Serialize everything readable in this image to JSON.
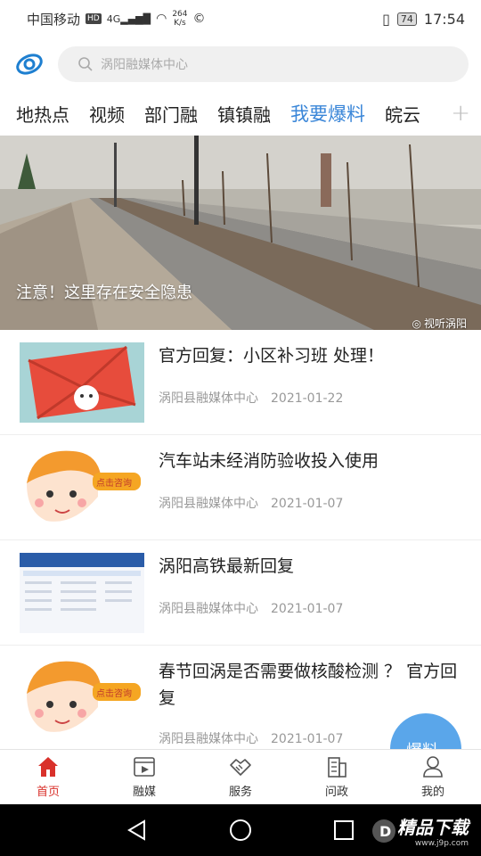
{
  "status_bar": {
    "carrier": "中国移动",
    "hd": "HD",
    "network": "4G",
    "speed_value": "264",
    "speed_unit": "K/s",
    "battery": "74",
    "time": "17:54"
  },
  "header": {
    "search_placeholder": "涡阳融媒体中心"
  },
  "tabs": [
    {
      "label": "地热点",
      "active": false
    },
    {
      "label": "视频",
      "active": false
    },
    {
      "label": "部门融",
      "active": false
    },
    {
      "label": "镇镇融",
      "active": false
    },
    {
      "label": "我要爆料",
      "active": true
    },
    {
      "label": "皖云",
      "active": false
    }
  ],
  "banner": {
    "caption": "注意！这里存在安全隐患",
    "watermark": "视听涡阳"
  },
  "articles": [
    {
      "title": "官方回复：小区补习班 处理！",
      "source": "涡阳县融媒体中心",
      "date": "2021-01-22"
    },
    {
      "title": "汽车站未经消防验收投入使用",
      "source": "涡阳县融媒体中心",
      "date": "2021-01-07",
      "thumb_badge": "点击咨询"
    },
    {
      "title": "涡阳高铁最新回复",
      "source": "涡阳县融媒体中心",
      "date": "2021-01-07"
    },
    {
      "title": "春节回涡是否需要做核酸检测 ？ 官方回复",
      "source": "涡阳县融媒体中心",
      "date": "2021-01-07",
      "thumb_badge": "点击咨询"
    }
  ],
  "fab": {
    "label": "爆料"
  },
  "bottom_nav": [
    {
      "label": "首页",
      "icon": "home-icon",
      "active": true
    },
    {
      "label": "融媒",
      "icon": "video-icon",
      "active": false
    },
    {
      "label": "服务",
      "icon": "handshake-icon",
      "active": false
    },
    {
      "label": "问政",
      "icon": "building-icon",
      "active": false
    },
    {
      "label": "我的",
      "icon": "user-icon",
      "active": false
    }
  ],
  "watermark": {
    "text": "精品下载",
    "url_text": "www.j9p.com"
  },
  "colors": {
    "accent": "#3a86d8",
    "nav_active": "#d9312b",
    "fab": "#5aa6ea"
  }
}
